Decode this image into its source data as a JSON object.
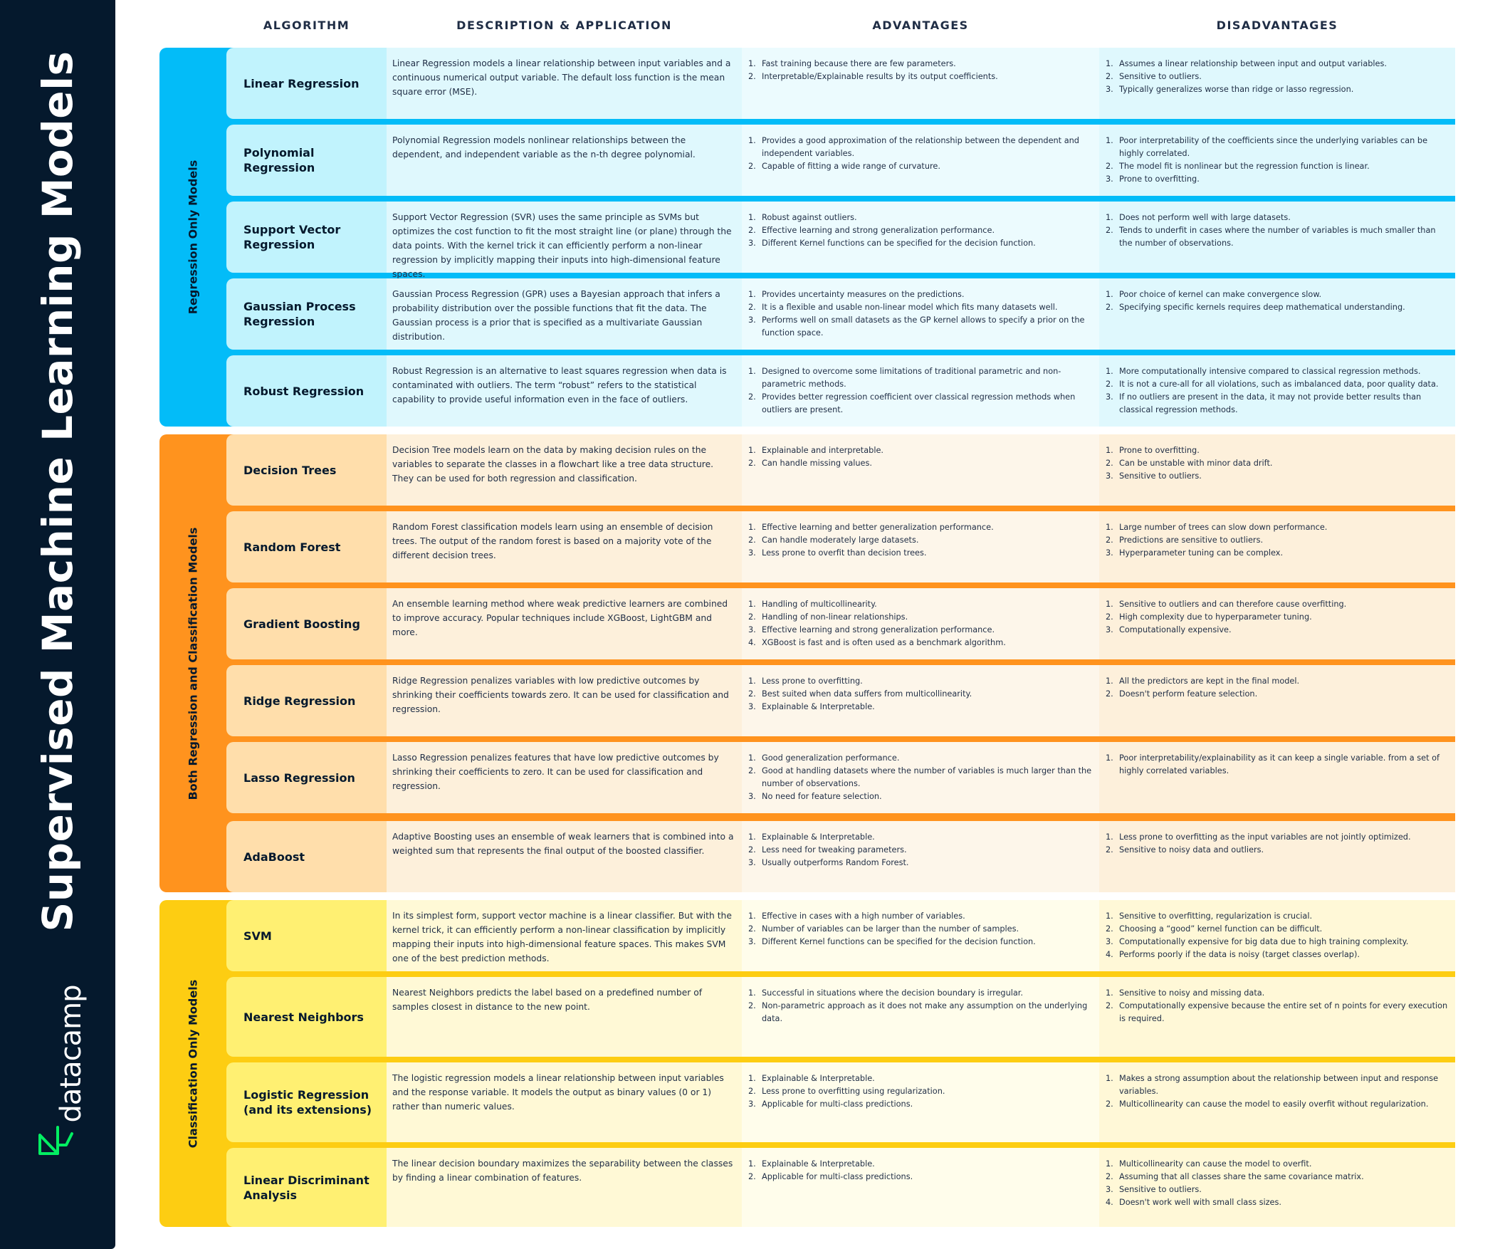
{
  "sidebar": {
    "title": "Supervised Machine Learning Models",
    "logo_text": "datacamp",
    "logo_color": "#03ef62"
  },
  "headers": {
    "algorithm": "ALGORITHM",
    "description": "DESCRIPTION & APPLICATION",
    "advantages": "ADVANTAGES",
    "disadvantages": "DISADVANTAGES"
  },
  "colors": {
    "regression_accent": "#03bcf8",
    "both_accent": "#ff931e",
    "classification_accent": "#fdcd12",
    "sidebar_bg": "#05192d"
  },
  "groups": [
    {
      "label": "Regression Only Models",
      "rows": [
        {
          "name": "Linear Regression",
          "description": "Linear Regression models a linear relationship between input variables and a continuous numerical output variable. The default loss function is the mean square error (MSE).",
          "advantages": [
            "Fast training because there are few parameters.",
            "Interpretable/Explainable results by its output coefficients."
          ],
          "disadvantages": [
            "Assumes a linear relationship between input and output variables.",
            "Sensitive to outliers.",
            "Typically generalizes worse than ridge or lasso regression."
          ]
        },
        {
          "name": "Polynomial Regression",
          "description": "Polynomial Regression models nonlinear relationships between the dependent, and independent variable as the n-th degree polynomial.",
          "advantages": [
            "Provides a good approximation of the relationship between the dependent and independent variables.",
            "Capable of fitting a wide range of curvature."
          ],
          "disadvantages": [
            "Poor interpretability of the coefficients since the underlying variables can be highly correlated.",
            "The model fit is nonlinear but the regression function is linear.",
            "Prone to overfitting."
          ]
        },
        {
          "name": "Support Vector Regression",
          "description": "Support Vector Regression (SVR) uses the same principle as SVMs but optimizes the cost function to fit the most straight line (or plane) through the data points. With the kernel trick it can efficiently perform a non-linear regression by implicitly mapping their inputs into high-dimensional feature spaces.",
          "advantages": [
            "Robust against outliers.",
            "Effective learning and strong generalization performance.",
            "Different Kernel functions can be specified for the decision function."
          ],
          "disadvantages": [
            "Does not perform well with large datasets.",
            "Tends to underfit in cases where the number of variables is much smaller than the number of observations."
          ]
        },
        {
          "name": "Gaussian Process Regression",
          "description": "Gaussian Process Regression (GPR) uses a Bayesian approach that infers a probability distribution over the possible functions that fit the data. The Gaussian process is a prior that is specified as a multivariate Gaussian distribution.",
          "advantages": [
            "Provides uncertainty measures on the predictions.",
            "It is a flexible and usable non-linear model which fits many datasets well.",
            "Performs well on small datasets as the GP kernel allows to specify a prior on the function space."
          ],
          "disadvantages": [
            "Poor choice of kernel can make convergence slow.",
            "Specifying specific kernels requires deep mathematical understanding."
          ]
        },
        {
          "name": "Robust Regression",
          "description": "Robust Regression is an alternative to least squares regression when data is contaminated with outliers. The term “robust” refers to the statistical capability to provide useful information even in the face of outliers.",
          "advantages": [
            "Designed to overcome some limitations of traditional parametric and non-parametric methods.",
            "Provides better regression coefficient over classical regression methods when outliers are present."
          ],
          "disadvantages": [
            "More computationally intensive compared to classical regression methods.",
            "It is not a cure-all for all violations, such as imbalanced data, poor quality data.",
            "If no outliers are present in the data, it may not provide better results than classical regression methods."
          ]
        }
      ]
    },
    {
      "label": "Both Regression and Classification Models",
      "rows": [
        {
          "name": "Decision Trees",
          "description": "Decision Tree models learn on the data by making decision rules on the variables to separate the classes in a flowchart like a tree data structure. They can be used for both regression and classification.",
          "advantages": [
            "Explainable and interpretable.",
            "Can handle missing values."
          ],
          "disadvantages": [
            "Prone to overfitting.",
            "Can be unstable with minor data drift.",
            "Sensitive to outliers."
          ]
        },
        {
          "name": "Random Forest",
          "description": "Random Forest classification models learn using an ensemble of decision trees. The output of the random forest is based on a majority vote of the different decision trees.",
          "advantages": [
            "Effective learning and better generalization performance.",
            "Can handle moderately large datasets.",
            "Less prone to overfit than decision trees."
          ],
          "disadvantages": [
            "Large number of trees can slow down performance.",
            "Predictions are sensitive to outliers.",
            "Hyperparameter tuning can be complex."
          ]
        },
        {
          "name": "Gradient Boosting",
          "description": "An ensemble learning method where weak predictive learners are combined to improve accuracy. Popular techniques include XGBoost, LightGBM and more.",
          "advantages": [
            "Handling of multicollinearity.",
            "Handling of non-linear relationships.",
            "Effective learning and strong generalization performance.",
            "XGBoost is fast and is often used as a benchmark algorithm."
          ],
          "disadvantages": [
            "Sensitive to outliers and can therefore cause overfitting.",
            "High complexity due to hyperparameter tuning.",
            "Computationally expensive."
          ]
        },
        {
          "name": "Ridge Regression",
          "description": "Ridge Regression penalizes variables with low predictive outcomes by shrinking their coefficients towards zero. It can be used for classification and regression.",
          "advantages": [
            "Less prone to overfitting.",
            "Best suited when data suffers from multicollinearity.",
            "Explainable & Interpretable."
          ],
          "disadvantages": [
            "All the predictors are kept in the final model.",
            "Doesn't perform feature selection."
          ]
        },
        {
          "name": "Lasso Regression",
          "description": "Lasso Regression penalizes features that have low predictive outcomes by shrinking their coefficients to zero. It can be used for classification and regression.",
          "advantages": [
            "Good generalization performance.",
            "Good at handling datasets where the number of variables is much larger than the number of observations.",
            "No need for feature selection."
          ],
          "disadvantages": [
            "Poor interpretability/explainability as it can keep a single variable. from a set of highly correlated variables."
          ]
        },
        {
          "name": "AdaBoost",
          "description": "Adaptive Boosting uses an ensemble of weak learners that is combined into a weighted sum that represents the final output of the boosted classifier.",
          "advantages": [
            "Explainable & Interpretable.",
            "Less need for tweaking parameters.",
            "Usually outperforms Random Forest."
          ],
          "disadvantages": [
            "Less prone to overfitting as the input variables are not jointly optimized.",
            "Sensitive to noisy data and outliers."
          ]
        }
      ]
    },
    {
      "label": "Classification Only Models",
      "rows": [
        {
          "name": "SVM",
          "description": "In its simplest form, support vector machine is a linear classifier. But with the kernel trick, it can efficiently perform a non-linear classification by implicitly mapping their inputs into high-dimensional feature spaces. This makes SVM one of the best prediction methods.",
          "advantages": [
            "Effective in cases with a high number of variables.",
            "Number of variables can be larger than the number of samples.",
            "Different Kernel functions can be specified for the decision function."
          ],
          "disadvantages": [
            "Sensitive to overfitting, regularization is crucial.",
            "Choosing a “good” kernel function can be difficult.",
            "Computationally expensive for big data due to high training complexity.",
            "Performs poorly if the data is noisy (target classes overlap)."
          ]
        },
        {
          "name": "Nearest Neighbors",
          "description": "Nearest Neighbors predicts the label based on a predefined number of samples closest in distance to the new point.",
          "advantages": [
            "Successful in situations where the decision boundary is irregular.",
            "Non-parametric approach as it does not make any assumption on the underlying data."
          ],
          "disadvantages": [
            "Sensitive to noisy and missing data.",
            "Computationally expensive because the entire set of n points for every execution is required."
          ]
        },
        {
          "name": "Logistic Regression (and its extensions)",
          "description": "The logistic regression models a linear relationship between input variables and the response variable. It models the output as binary values (0 or 1) rather than numeric values.",
          "advantages": [
            "Explainable & Interpretable.",
            "Less prone to overfitting using regularization.",
            "Applicable for multi-class predictions."
          ],
          "disadvantages": [
            "Makes a strong assumption about the relationship between input and response variables.",
            "Multicollinearity can cause the model to easily overfit without regularization."
          ]
        },
        {
          "name": "Linear Discriminant Analysis",
          "description": "The linear decision boundary maximizes the separability between the classes by finding a linear combination of features.",
          "advantages": [
            "Explainable & Interpretable.",
            "Applicable for multi-class predictions."
          ],
          "disadvantages": [
            "Multicollinearity can cause the model to overfit.",
            "Assuming that all classes share the same covariance matrix.",
            "Sensitive to outliers.",
            "Doesn't work well with small class sizes."
          ]
        }
      ]
    }
  ]
}
